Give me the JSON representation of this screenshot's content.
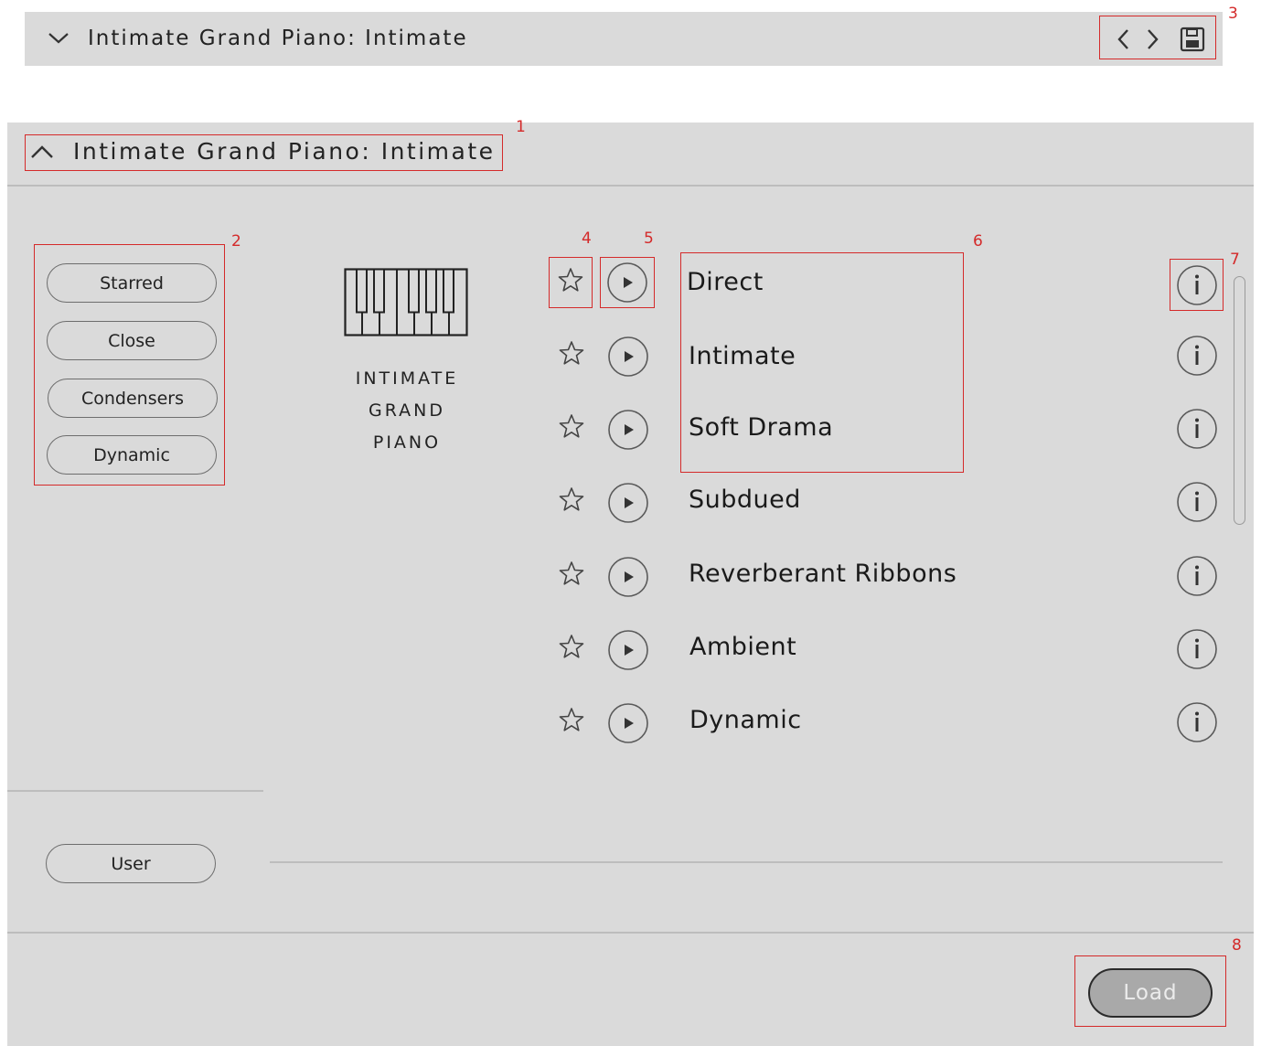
{
  "collapsed_header": {
    "title": "Intimate Grand Piano: Intimate",
    "annotation": "3"
  },
  "panel": {
    "title": "Intimate Grand Piano: Intimate",
    "title_annotation": "1",
    "tags_annotation": "2",
    "star_annotation": "4",
    "play_annotation": "5",
    "names_annotation": "6",
    "info_annotation": "7",
    "load_annotation": "8"
  },
  "tags": [
    "Starred",
    "Close",
    "Condensers",
    "Dynamic"
  ],
  "user_tag": "User",
  "instrument": {
    "line1": "INTIMATE",
    "line2": "GRAND",
    "line3": "PIANO"
  },
  "presets": [
    {
      "name": "Direct"
    },
    {
      "name": "Intimate"
    },
    {
      "name": "Soft Drama"
    },
    {
      "name": "Subdued"
    },
    {
      "name": "Reverberant Ribbons"
    },
    {
      "name": "Ambient"
    },
    {
      "name": "Dynamic"
    }
  ],
  "load_label": "Load",
  "colors": {
    "panel_bg": "#dadada",
    "annotation": "#d42a2a",
    "load_bg": "#a9a9a9"
  },
  "icons": [
    "chevron-down-icon",
    "chevron-up-icon",
    "chevron-left-icon",
    "chevron-right-icon",
    "save-icon",
    "star-icon",
    "play-icon",
    "info-icon",
    "piano-icon"
  ]
}
